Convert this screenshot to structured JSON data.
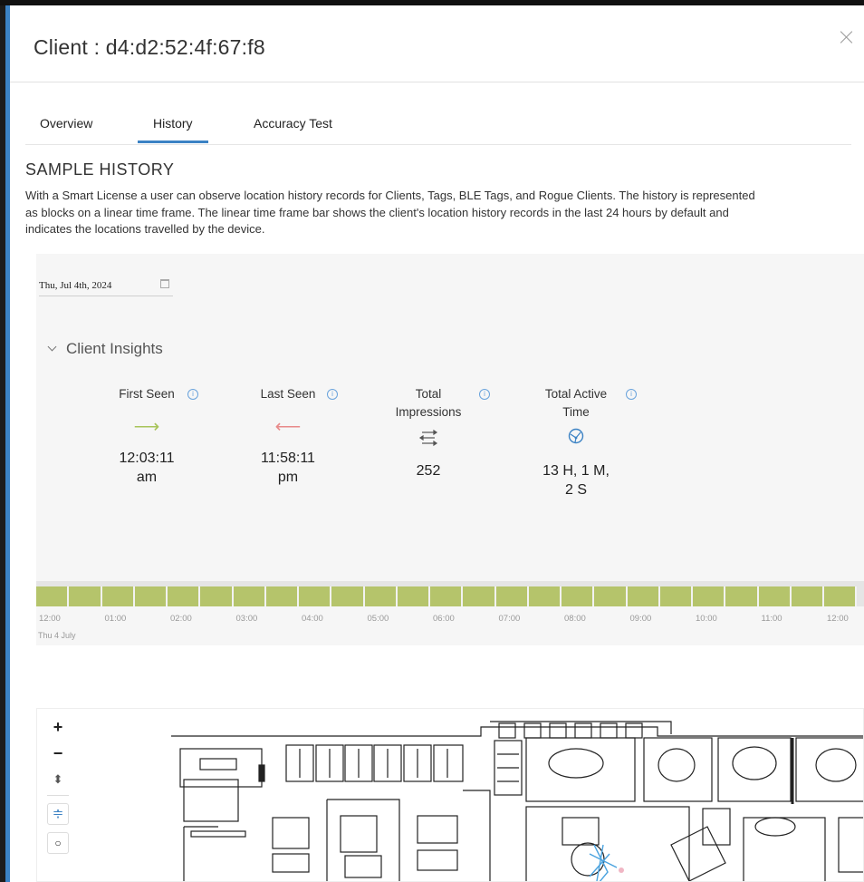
{
  "modal": {
    "title": "Client : d4:d2:52:4f:67:f8"
  },
  "tabs": [
    {
      "label": "Overview",
      "active": false
    },
    {
      "label": "History",
      "active": true
    },
    {
      "label": "Accuracy Test",
      "active": false
    }
  ],
  "section": {
    "title": "SAMPLE HISTORY",
    "description": "With a Smart License a user can observe location history records for Clients, Tags, BLE Tags, and Rogue Clients. The history is represented as blocks on a linear time frame. The linear time frame bar shows the client's location history records in the last 24 hours by default and indicates the locations travelled by the device."
  },
  "date_picker": {
    "value": "Thu, Jul 4th, 2024",
    "icon": "calendar-icon"
  },
  "insights": {
    "title": "Client Insights",
    "metrics": [
      {
        "label": "First Seen",
        "value": "12:03:11 am",
        "icon": "arrow-right-icon",
        "color": "#a8c45a"
      },
      {
        "label": "Last Seen",
        "value": "11:58:11 pm",
        "icon": "arrow-left-icon",
        "color": "#e88a8a"
      },
      {
        "label": "Total Impressions",
        "value": "252",
        "icon": "arrows-exchange-icon",
        "color": "#555555"
      },
      {
        "label": "Total Active Time",
        "value": "13 H, 1 M, 2 S",
        "icon": "network-globe-icon",
        "color": "#3b82c4"
      }
    ]
  },
  "timeline": {
    "ticks": [
      "12:00",
      "01:00",
      "02:00",
      "03:00",
      "04:00",
      "05:00",
      "06:00",
      "07:00",
      "08:00",
      "09:00",
      "10:00",
      "11:00",
      "12:00"
    ],
    "date_label": "Thu 4 July",
    "block_color": "#b5c46b"
  },
  "map": {
    "controls": [
      {
        "name": "zoom-in",
        "glyph": "+"
      },
      {
        "name": "zoom-out",
        "glyph": "−"
      },
      {
        "name": "rotate",
        "glyph": "⬍"
      },
      {
        "name": "layers",
        "glyph": "≑"
      },
      {
        "name": "reset",
        "glyph": "○"
      }
    ]
  },
  "colors": {
    "accent": "#3b82c4",
    "timeline_block": "#b5c46b"
  }
}
